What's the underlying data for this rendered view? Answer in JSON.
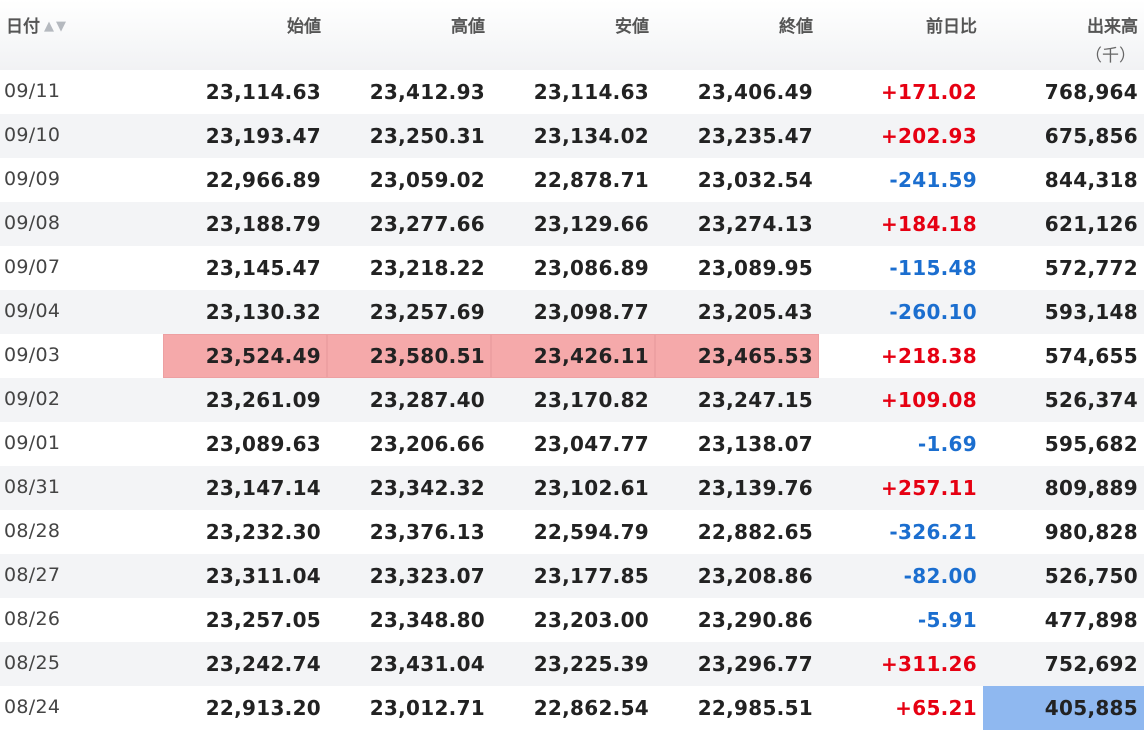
{
  "headers": {
    "date": "日付",
    "open": "始値",
    "high": "高値",
    "low": "安値",
    "close": "終値",
    "change": "前日比",
    "volume": "出来高",
    "volume_unit": "（千）"
  },
  "rows": [
    {
      "date": "09/11",
      "open": "23,114.63",
      "high": "23,412.93",
      "low": "23,114.63",
      "close": "23,406.49",
      "change": "+171.02",
      "volume": "768,964"
    },
    {
      "date": "09/10",
      "open": "23,193.47",
      "high": "23,250.31",
      "low": "23,134.02",
      "close": "23,235.47",
      "change": "+202.93",
      "volume": "675,856"
    },
    {
      "date": "09/09",
      "open": "22,966.89",
      "high": "23,059.02",
      "low": "22,878.71",
      "close": "23,032.54",
      "change": "-241.59",
      "volume": "844,318"
    },
    {
      "date": "09/08",
      "open": "23,188.79",
      "high": "23,277.66",
      "low": "23,129.66",
      "close": "23,274.13",
      "change": "+184.18",
      "volume": "621,126"
    },
    {
      "date": "09/07",
      "open": "23,145.47",
      "high": "23,218.22",
      "low": "23,086.89",
      "close": "23,089.95",
      "change": "-115.48",
      "volume": "572,772"
    },
    {
      "date": "09/04",
      "open": "23,130.32",
      "high": "23,257.69",
      "low": "23,098.77",
      "close": "23,205.43",
      "change": "-260.10",
      "volume": "593,148"
    },
    {
      "date": "09/03",
      "open": "23,524.49",
      "high": "23,580.51",
      "low": "23,426.11",
      "close": "23,465.53",
      "change": "+218.38",
      "volume": "574,655"
    },
    {
      "date": "09/02",
      "open": "23,261.09",
      "high": "23,287.40",
      "low": "23,170.82",
      "close": "23,247.15",
      "change": "+109.08",
      "volume": "526,374"
    },
    {
      "date": "09/01",
      "open": "23,089.63",
      "high": "23,206.66",
      "low": "23,047.77",
      "close": "23,138.07",
      "change": "-1.69",
      "volume": "595,682"
    },
    {
      "date": "08/31",
      "open": "23,147.14",
      "high": "23,342.32",
      "low": "23,102.61",
      "close": "23,139.76",
      "change": "+257.11",
      "volume": "809,889"
    },
    {
      "date": "08/28",
      "open": "23,232.30",
      "high": "23,376.13",
      "low": "22,594.79",
      "close": "22,882.65",
      "change": "-326.21",
      "volume": "980,828"
    },
    {
      "date": "08/27",
      "open": "23,311.04",
      "high": "23,323.07",
      "low": "23,177.85",
      "close": "23,208.86",
      "change": "-82.00",
      "volume": "526,750"
    },
    {
      "date": "08/26",
      "open": "23,257.05",
      "high": "23,348.80",
      "low": "23,203.00",
      "close": "23,290.86",
      "change": "-5.91",
      "volume": "477,898"
    },
    {
      "date": "08/25",
      "open": "23,242.74",
      "high": "23,431.04",
      "low": "23,225.39",
      "close": "23,296.77",
      "change": "+311.26",
      "volume": "752,692"
    },
    {
      "date": "08/24",
      "open": "22,913.20",
      "high": "23,012.71",
      "low": "22,862.54",
      "close": "22,985.51",
      "change": "+65.21",
      "volume": "405,885"
    }
  ],
  "colors": {
    "up": "#e60012",
    "down": "#1b6ecf",
    "highlight_high_row": "#f5a9aa",
    "highlight_volume": "#8fb8f0"
  },
  "icons": {
    "sort_ascending": "triangle-up-icon",
    "sort_descending": "triangle-down-icon"
  }
}
